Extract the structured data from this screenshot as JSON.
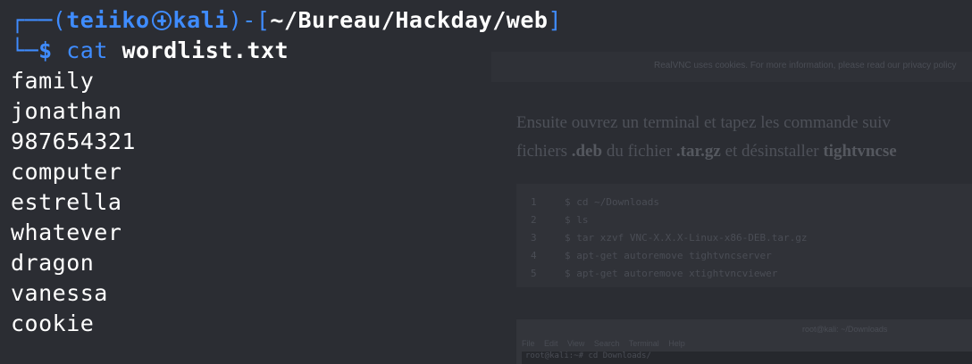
{
  "background_page": {
    "cookie_notice": "RealVNC uses cookies. For more information, please read our privacy policy",
    "paragraph_line1": "Ensuite ouvrez un terminal et tapez les commande suiv",
    "paragraph_line2_a": "fichiers ",
    "paragraph_line2_b": ".deb",
    "paragraph_line2_c": " du fichier ",
    "paragraph_line2_d": ".tar.gz",
    "paragraph_line2_e": " et désinstaller ",
    "paragraph_line2_f": "tightvncse",
    "code_lines": [
      {
        "num": "1",
        "text": "$ cd ~/Downloads"
      },
      {
        "num": "2",
        "text": "$ ls"
      },
      {
        "num": "3",
        "text": "$ tar xzvf VNC-X.X.X-Linux-x86-DEB.tar.gz"
      },
      {
        "num": "4",
        "text": "$ apt-get autoremove tightvncserver"
      },
      {
        "num": "5",
        "text": "$ apt-get autoremove xtightvncviewer"
      }
    ],
    "terminal_title": "root@kali: ~/Downloads",
    "terminal_menu": "File Edit View Search Terminal Help",
    "terminal_cmd": "root@kali:~# cd Downloads/"
  },
  "prompt": {
    "corner_top": "┌──(",
    "user": "teiiko",
    "host": "kali",
    "sep": ")-[",
    "path": "~/Bureau/Hackday/web",
    "close": "]",
    "corner_bottom": "└─",
    "dollar": "$",
    "command": "cat",
    "argument": "wordlist.txt"
  },
  "output_lines": [
    "family",
    "jonathan",
    "987654321",
    "computer",
    "estrella",
    "whatever",
    "dragon",
    "vanessa",
    "cookie"
  ],
  "colors": {
    "background": "#2b2d33",
    "accent": "#3f8cff",
    "text": "#ffffff"
  },
  "icons": {
    "prompt_separator": "kali-dragon-icon"
  }
}
